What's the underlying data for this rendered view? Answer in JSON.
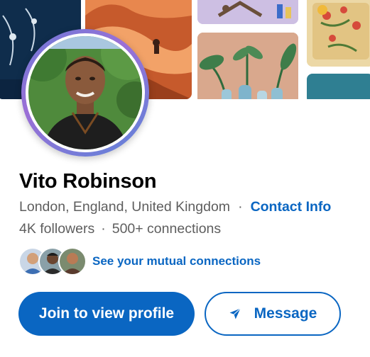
{
  "profile": {
    "name": "Vito Robinson",
    "location": "London, England, United Kingdom",
    "separator": "·",
    "contact_info_label": "Contact Info",
    "followers": "4K followers",
    "connections": "500+ connections"
  },
  "mutual": {
    "link_label": "See your mutual connections"
  },
  "actions": {
    "join_label": "Join to view profile",
    "message_label": "Message"
  },
  "colors": {
    "accent": "#0a66c2",
    "text_secondary": "#5e5e5e",
    "avatar_ring": "#7b6fd6"
  },
  "icons": {
    "message_button": "send-icon"
  }
}
